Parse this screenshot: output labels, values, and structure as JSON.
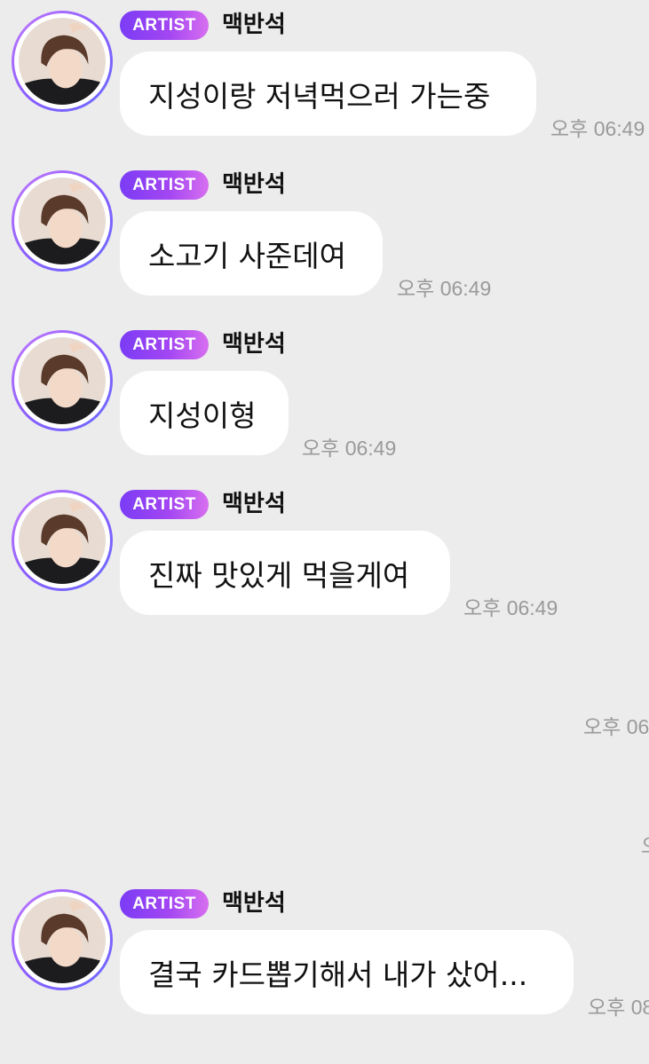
{
  "chat": {
    "messages": [
      {
        "badge": "ARTIST",
        "sender": "맥반석",
        "text": "지성이랑 저녁먹으러 가는중",
        "time": "오후 06:49"
      },
      {
        "badge": "ARTIST",
        "sender": "맥반석",
        "text": "소고기 사준데여",
        "time": "오후 06:49"
      },
      {
        "badge": "ARTIST",
        "sender": "맥반석",
        "text": "지성이형",
        "time": "오후 06:49"
      },
      {
        "badge": "ARTIST",
        "sender": "맥반석",
        "text": "진짜 맛있게 먹을게여",
        "time": "오후 06:49"
      },
      {
        "badge": "ARTIST",
        "sender": "맥반석",
        "text": "결국 카드뽑기해서 내가 샀어...",
        "time": "오후 08"
      }
    ],
    "hidden_message_times": [
      "오후 06",
      "오"
    ]
  },
  "colors": {
    "background": "#ececec",
    "bubble": "#ffffff",
    "badge_gradient_start": "#7b3cf5",
    "badge_gradient_end": "#d86ff0",
    "timestamp": "#9a9a9a"
  }
}
